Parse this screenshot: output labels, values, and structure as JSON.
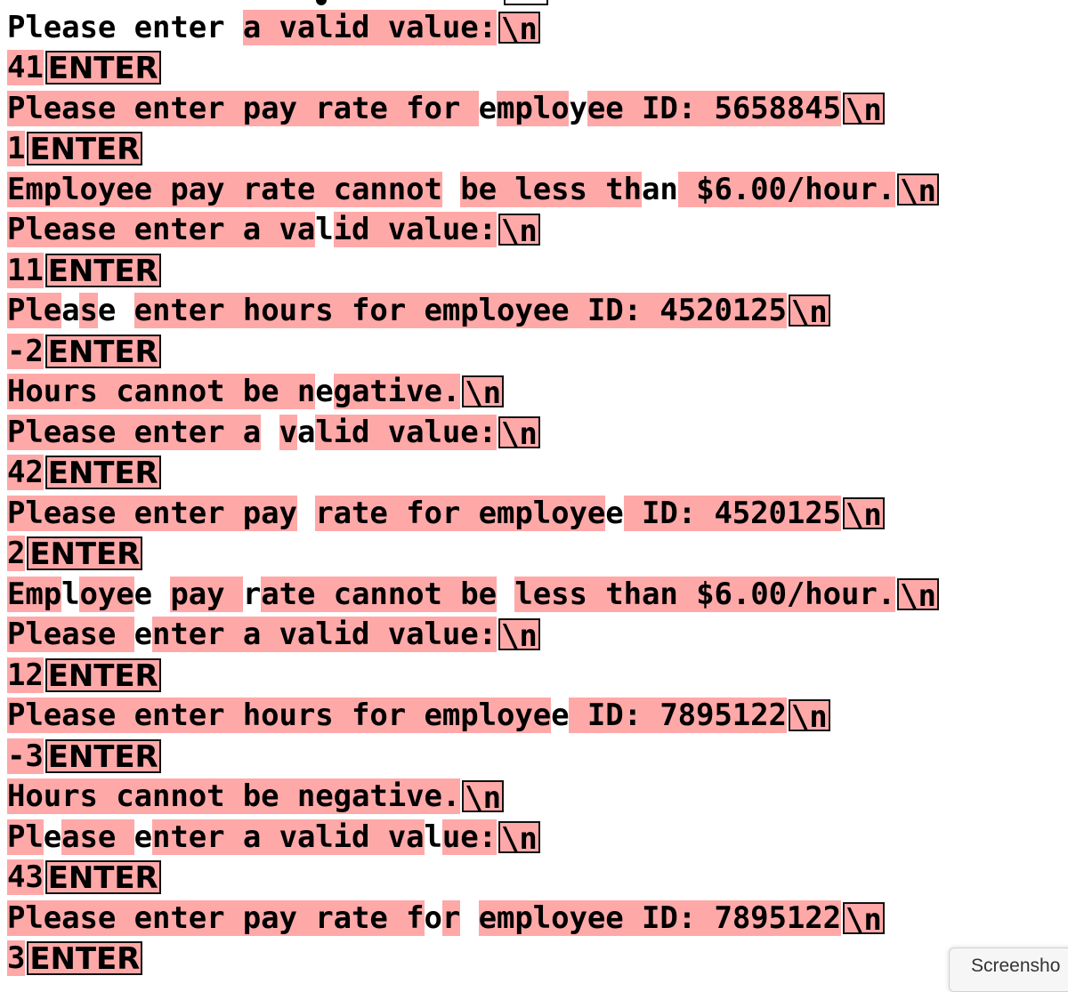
{
  "highlight_color": "#ffa8a8",
  "tooltip": {
    "label": "Screensho"
  },
  "lines": [
    {
      "segments": [
        {
          "text": "Please enter ",
          "hl": false
        },
        {
          "text": "a valid value:",
          "hl": true
        }
      ],
      "marker": "\\n"
    },
    {
      "segments": [
        {
          "text": "41",
          "hl": true
        }
      ],
      "marker": "ENTER"
    },
    {
      "segments": [
        {
          "text": "Please enter pay rate for ",
          "hl": true
        },
        {
          "text": "e",
          "hl": false
        },
        {
          "text": "mplo",
          "hl": true
        },
        {
          "text": "y",
          "hl": false
        },
        {
          "text": "ee ID: 5658845",
          "hl": true
        }
      ],
      "marker": "\\n"
    },
    {
      "segments": [
        {
          "text": "1",
          "hl": true
        }
      ],
      "marker": "ENTER"
    },
    {
      "segments": [
        {
          "text": "Employee pay rate cannot",
          "hl": true
        },
        {
          "text": " ",
          "hl": false
        },
        {
          "text": "be less th",
          "hl": true
        },
        {
          "text": "an",
          "hl": false
        },
        {
          "text": " $6.00/hour.",
          "hl": true
        }
      ],
      "marker": "\\n"
    },
    {
      "segments": [
        {
          "text": "Please enter a va",
          "hl": true
        },
        {
          "text": "l",
          "hl": false
        },
        {
          "text": "id value:",
          "hl": true
        }
      ],
      "marker": "\\n"
    },
    {
      "segments": [
        {
          "text": "11",
          "hl": true
        }
      ],
      "marker": "ENTER"
    },
    {
      "segments": [
        {
          "text": "Ple",
          "hl": true
        },
        {
          "text": "a",
          "hl": false
        },
        {
          "text": "s",
          "hl": true
        },
        {
          "text": "e ",
          "hl": false
        },
        {
          "text": "enter hours for employee ID: 4520125",
          "hl": true
        }
      ],
      "marker": "\\n"
    },
    {
      "segments": [
        {
          "text": "-2",
          "hl": true
        }
      ],
      "marker": "ENTER"
    },
    {
      "segments": [
        {
          "text": "Hours cannot be n",
          "hl": true
        },
        {
          "text": "e",
          "hl": false
        },
        {
          "text": "gative.",
          "hl": true
        }
      ],
      "marker": "\\n"
    },
    {
      "segments": [
        {
          "text": "Please enter a",
          "hl": true
        },
        {
          "text": " ",
          "hl": false
        },
        {
          "text": "v",
          "hl": true
        },
        {
          "text": "a",
          "hl": false
        },
        {
          "text": "lid value:",
          "hl": true
        }
      ],
      "marker": "\\n"
    },
    {
      "segments": [
        {
          "text": "42",
          "hl": true
        }
      ],
      "marker": "ENTER"
    },
    {
      "segments": [
        {
          "text": "Please enter pay",
          "hl": true
        },
        {
          "text": " ",
          "hl": false
        },
        {
          "text": "rate for employe",
          "hl": true
        },
        {
          "text": "e",
          "hl": false
        },
        {
          "text": " ID: 4520125",
          "hl": true
        }
      ],
      "marker": "\\n"
    },
    {
      "segments": [
        {
          "text": "2",
          "hl": true
        }
      ],
      "marker": "ENTER"
    },
    {
      "segments": [
        {
          "text": "Emp",
          "hl": true
        },
        {
          "text": "l",
          "hl": false
        },
        {
          "text": "oye",
          "hl": true
        },
        {
          "text": "e ",
          "hl": false
        },
        {
          "text": "pay ",
          "hl": true
        },
        {
          "text": "r",
          "hl": false
        },
        {
          "text": "ate cannot be",
          "hl": true
        },
        {
          "text": " ",
          "hl": false
        },
        {
          "text": "less than $6.00/hour.",
          "hl": true
        }
      ],
      "marker": "\\n"
    },
    {
      "segments": [
        {
          "text": "Please ",
          "hl": true
        },
        {
          "text": "e",
          "hl": false
        },
        {
          "text": "nter a valid value:",
          "hl": true
        }
      ],
      "marker": "\\n"
    },
    {
      "segments": [
        {
          "text": "12",
          "hl": true
        }
      ],
      "marker": "ENTER"
    },
    {
      "segments": [
        {
          "text": "Please enter hours for employe",
          "hl": true
        },
        {
          "text": "e",
          "hl": false
        },
        {
          "text": " ID: 7895122",
          "hl": true
        }
      ],
      "marker": "\\n"
    },
    {
      "segments": [
        {
          "text": "-3",
          "hl": true
        }
      ],
      "marker": "ENTER"
    },
    {
      "segments": [
        {
          "text": "Hours cannot be negative.",
          "hl": true
        }
      ],
      "marker": "\\n"
    },
    {
      "segments": [
        {
          "text": "Pl",
          "hl": true
        },
        {
          "text": "e",
          "hl": false
        },
        {
          "text": "ase ",
          "hl": true
        },
        {
          "text": "e",
          "hl": false
        },
        {
          "text": "nter a valid va",
          "hl": true
        },
        {
          "text": "l",
          "hl": false
        },
        {
          "text": "ue:",
          "hl": true
        }
      ],
      "marker": "\\n"
    },
    {
      "segments": [
        {
          "text": "43",
          "hl": true
        }
      ],
      "marker": "ENTER"
    },
    {
      "segments": [
        {
          "text": "Please enter pay rate f",
          "hl": true
        },
        {
          "text": "o",
          "hl": false
        },
        {
          "text": "r",
          "hl": true
        },
        {
          "text": " ",
          "hl": false
        },
        {
          "text": "employee ID: 7895122",
          "hl": true
        }
      ],
      "marker": "\\n"
    },
    {
      "segments": [
        {
          "text": "3",
          "hl": true
        }
      ],
      "marker": "ENTER"
    }
  ]
}
